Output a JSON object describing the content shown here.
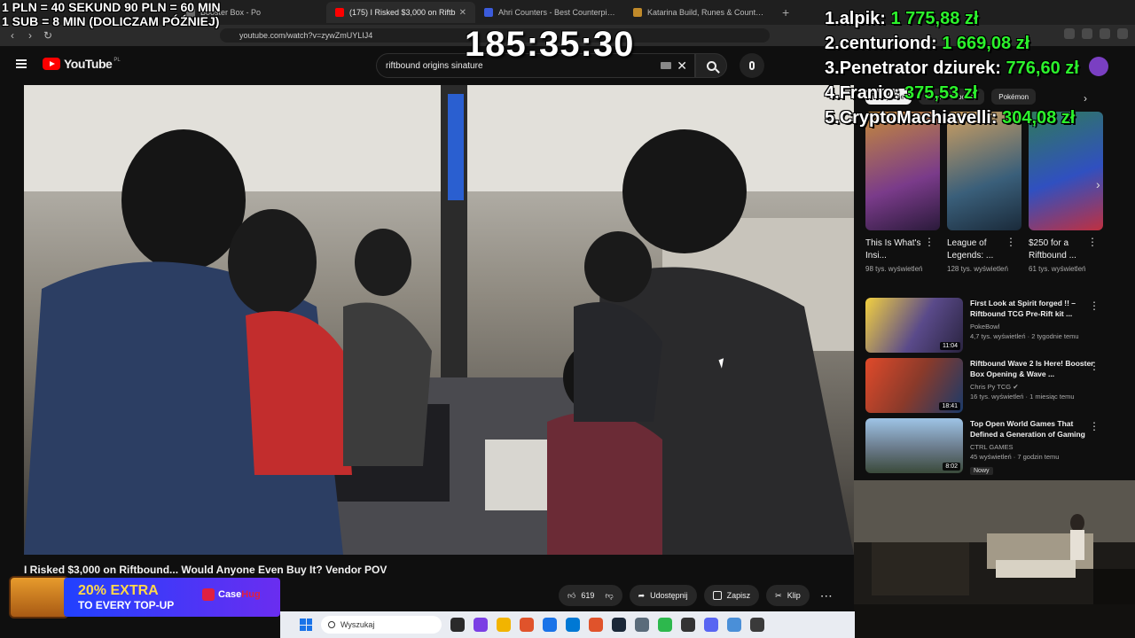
{
  "browser": {
    "tabs": [
      {
        "label": "Booster Box - Po",
        "color": "#6b6b6b"
      },
      {
        "label": "(175) I Risked $3,000 on Riftb",
        "color": "#ff0000",
        "active": true
      },
      {
        "label": "Ahri Counters - Best Counterpicks fo",
        "color": "#3b5bdb"
      },
      {
        "label": "Katarina Build, Runes & Counters Gu",
        "color": "#c08a2a"
      }
    ],
    "url": "youtube.com/watch?v=zywZmUYLIJ4"
  },
  "youtube": {
    "logo_text": "YouTube",
    "region": "PL",
    "search_value": "riftbound origins sinature",
    "chips": [
      "Wszystkie",
      "Z serii Riftbound",
      "Pokémon"
    ],
    "video_title": "I Risked $3,000 on Riftbound... Would Anyone Even Buy It? Vendor POV",
    "actions": {
      "likes": "619",
      "share": "Udostępnij",
      "save": "Zapisz",
      "clip": "Klip"
    },
    "shorts": [
      {
        "title": "This Is What's Insi...",
        "views": "98 tys. wyświetleń",
        "color": "#7a3b8a"
      },
      {
        "title": "League of Legends: ...",
        "views": "128 tys. wyświetleń",
        "color": "#3a5f7a"
      },
      {
        "title": "$250 for a Riftbound ...",
        "views": "61 tys. wyświetleń",
        "color": "#2f7a5a"
      }
    ],
    "recommended": [
      {
        "title": "First Look at Spirit forged !! – Riftbound TCG Pre-Rift kit ...",
        "channel": "PokeBowl",
        "meta": "4,7 tys. wyświetleń · 2 tygodnie temu",
        "duration": "11:04",
        "color": "#5a4a8a"
      },
      {
        "title": "Riftbound Wave 2 Is Here! Booster Box Opening & Wave ...",
        "channel": "Chris Py TCG",
        "meta": "16 tys. wyświetleń · 1 miesiąc temu",
        "duration": "18:41",
        "color": "#8a3a2a"
      },
      {
        "title": "Top Open World Games That Defined a Generation of Gaming",
        "channel": "CTRL GAMES",
        "meta": "45 wyświetleń · 7 godzin temu",
        "duration": "8:02",
        "color": "#6a7a8a",
        "badge": "Nowy"
      }
    ]
  },
  "overlay": {
    "donation_line1": "1 PLN = 40 SEKUND 90 PLN = 60 MIN",
    "donation_line2": "1 SUB = 8 MIN (DOLICZAM PÓŹNIEJ)",
    "timer": "185:35:30",
    "leaderboard": [
      {
        "rank": "1.",
        "name": "alpik:",
        "amount": "1 775,88 zł"
      },
      {
        "rank": "2.",
        "name": "centuriond:",
        "amount": "1 669,08 zł"
      },
      {
        "rank": "3.",
        "name": "Penetrator dziurek:",
        "amount": "776,60 zł"
      },
      {
        "rank": "4.",
        "name": "Franio:",
        "amount": "375,53 zł"
      },
      {
        "rank": "5.",
        "name": "CryptoMachiavelli:",
        "amount": "304,08 zł"
      }
    ],
    "promo": {
      "highlight": "20% EXTRA",
      "line2": "TO EVERY TOP-UP",
      "brand_a": "Case",
      "brand_b": "Hug"
    }
  },
  "taskbar": {
    "search_placeholder": "Wyszukaj",
    "apps": [
      "#2a2a2a",
      "#7b3fe4",
      "#f2b400",
      "#e0532b",
      "#1a73e8",
      "#0078d4",
      "#e0532b",
      "#1b2838",
      "#5a6b7a",
      "#2db84d",
      "#333333",
      "#5865f2",
      "#4a8fd8",
      "#3a3a3a"
    ]
  }
}
